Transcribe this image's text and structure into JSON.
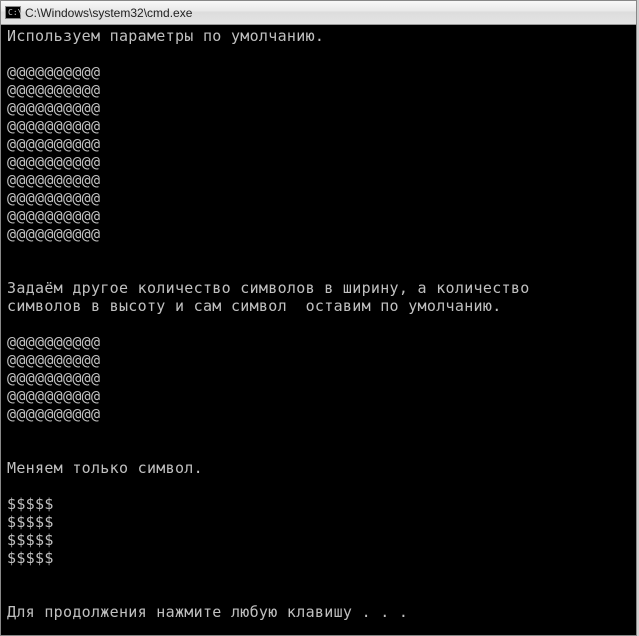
{
  "window": {
    "title": "C:\\Windows\\system32\\cmd.exe",
    "icon": "cmd-icon"
  },
  "output": {
    "msg1": "Используем параметры по умолчанию.",
    "block1": "@@@@@@@@@@\n@@@@@@@@@@\n@@@@@@@@@@\n@@@@@@@@@@\n@@@@@@@@@@\n@@@@@@@@@@\n@@@@@@@@@@\n@@@@@@@@@@\n@@@@@@@@@@\n@@@@@@@@@@",
    "msg2": "Задаём другое количество символов в ширину, а количество\nсимволов в высоту и сам символ  оставим по умолчанию.",
    "block2": "@@@@@@@@@@\n@@@@@@@@@@\n@@@@@@@@@@\n@@@@@@@@@@\n@@@@@@@@@@",
    "msg3": "Меняем только символ.",
    "block3": "$$$$$\n$$$$$\n$$$$$\n$$$$$",
    "prompt": "Для продолжения нажмите любую клавишу . . ."
  }
}
